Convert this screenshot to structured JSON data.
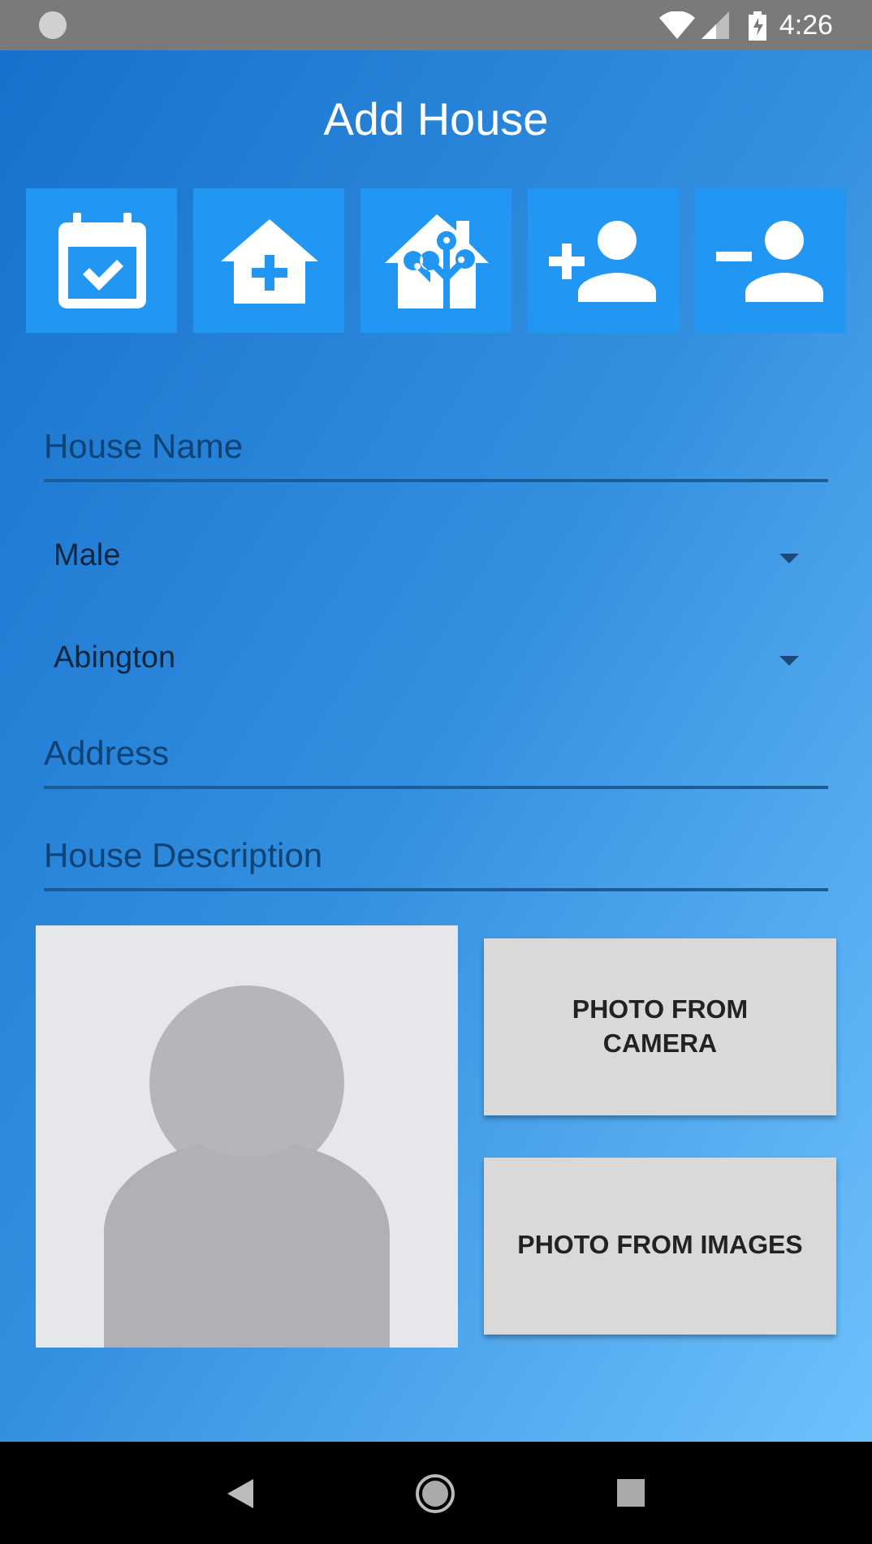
{
  "status_bar": {
    "time": "4:26"
  },
  "title": "Add House",
  "toolbar": [
    {
      "kind": "calendar-check"
    },
    {
      "kind": "house-plus"
    },
    {
      "kind": "house-tree"
    },
    {
      "kind": "person-add"
    },
    {
      "kind": "person-remove"
    }
  ],
  "form": [
    {
      "kind": "text",
      "placeholder": "House Name"
    },
    {
      "kind": "dropdown",
      "value": "Male"
    },
    {
      "kind": "dropdown",
      "value": "Abington"
    },
    {
      "kind": "text",
      "placeholder": "Address"
    },
    {
      "kind": "text",
      "placeholder": "House Description"
    }
  ],
  "photo_buttons": [
    "PHOTO FROM\nCAMERA",
    "PHOTO FROM IMAGES"
  ]
}
